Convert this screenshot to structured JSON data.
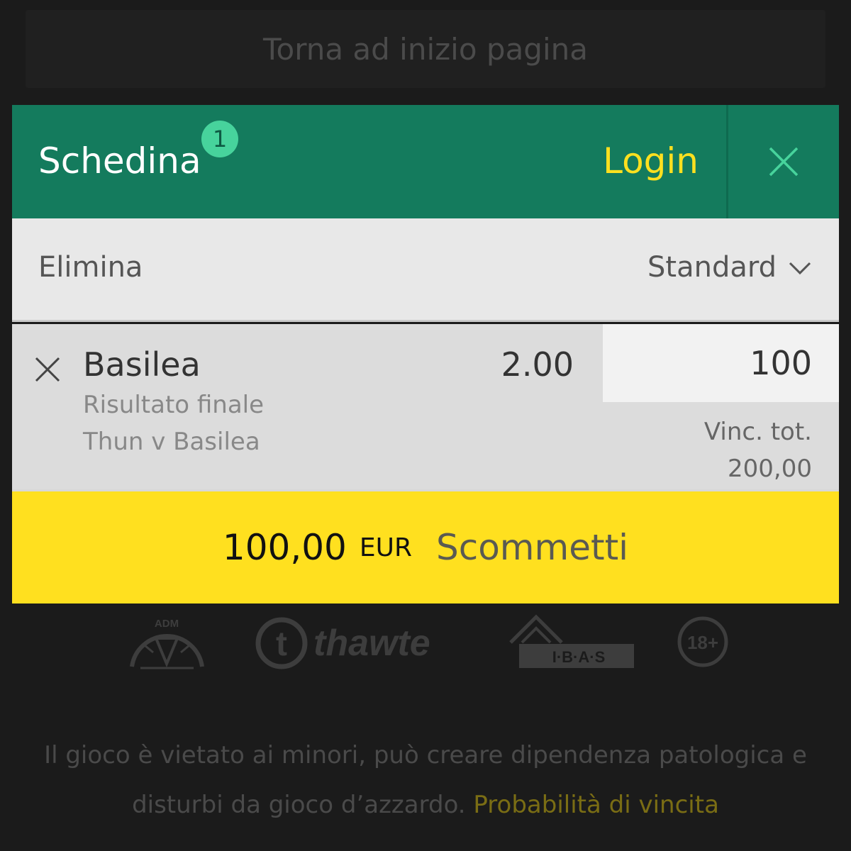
{
  "page": {
    "back_to_top": "Torna ad inizio pagina"
  },
  "betslip": {
    "title": "Schedina",
    "count": "1",
    "login": "Login",
    "delete_all": "Elimina",
    "bet_type": "Standard",
    "selection": {
      "name": "Basilea",
      "market": "Risultato finale",
      "event": "Thun v Basilea",
      "odds": "2.00",
      "stake": "100",
      "win_label": "Vinc. tot.",
      "win_value": "200,00"
    },
    "place_bet": {
      "amount": "100,00",
      "currency": "EUR",
      "label": "Scommetti"
    }
  },
  "footer": {
    "logos": {
      "adm": "ADM",
      "thawte": "thawte",
      "ibas": "I·B·A·S",
      "age": "18+"
    },
    "disclaimer_line1": "Il gioco è vietato ai minori, può creare dipendenza patologica e",
    "disclaimer_line2": "disturbi da gioco d’azzardo.",
    "odds_link": "Probabilità di vincita"
  },
  "colors": {
    "header_green": "#147b5d",
    "badge_green": "#47d39c",
    "accent_yellow": "#ffe01f",
    "background": "#1b1b1b"
  },
  "icons": [
    "close-icon",
    "chevron-down-icon",
    "remove-selection-icon"
  ]
}
